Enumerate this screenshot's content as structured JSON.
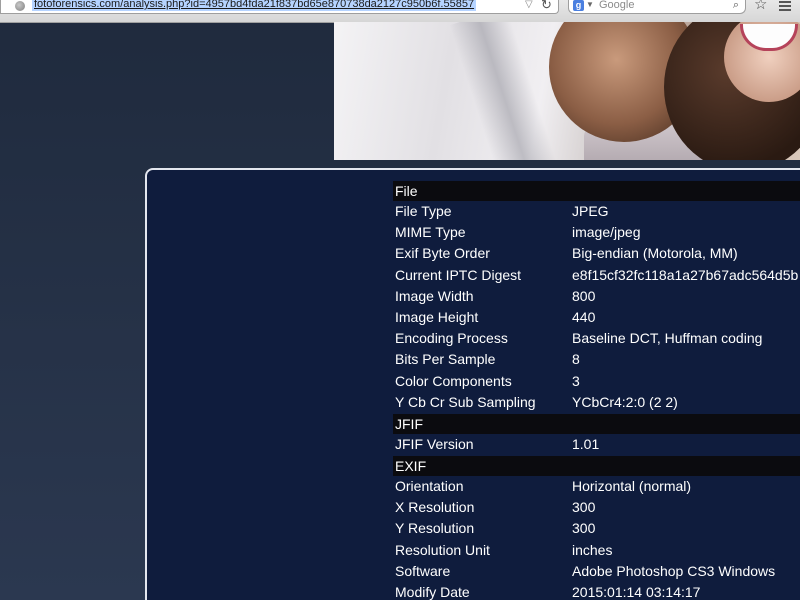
{
  "browser": {
    "url": "fotoforensics.com/analysis.php?id=4957bd4fda21f837bd65e870738da2127c950b6f.55857",
    "search_placeholder": "Google",
    "search_engine_letter": "g"
  },
  "metadata": {
    "sections": [
      {
        "title": "File",
        "rows": [
          {
            "key": "File Type",
            "value": "JPEG"
          },
          {
            "key": "MIME Type",
            "value": "image/jpeg"
          },
          {
            "key": "Exif Byte Order",
            "value": "Big-endian (Motorola, MM)"
          },
          {
            "key": "Current IPTC Digest",
            "value": "e8f15cf32fc118a1a27b67adc564d5b"
          },
          {
            "key": "Image Width",
            "value": "800"
          },
          {
            "key": "Image Height",
            "value": "440"
          },
          {
            "key": "Encoding Process",
            "value": "Baseline DCT, Huffman coding"
          },
          {
            "key": "Bits Per Sample",
            "value": "8"
          },
          {
            "key": "Color Components",
            "value": "3"
          },
          {
            "key": "Y Cb Cr Sub Sampling",
            "value": "YCbCr4:2:0 (2 2)"
          }
        ]
      },
      {
        "title": "JFIF",
        "rows": [
          {
            "key": "JFIF Version",
            "value": "1.01"
          }
        ]
      },
      {
        "title": "EXIF",
        "rows": [
          {
            "key": "Orientation",
            "value": "Horizontal (normal)"
          },
          {
            "key": "X Resolution",
            "value": "300"
          },
          {
            "key": "Y Resolution",
            "value": "300"
          },
          {
            "key": "Resolution Unit",
            "value": "inches"
          },
          {
            "key": "Software",
            "value": "Adobe Photoshop CS3 Windows"
          },
          {
            "key": "Modify Date",
            "value": "2015:01:14 03:14:17"
          }
        ]
      }
    ]
  }
}
